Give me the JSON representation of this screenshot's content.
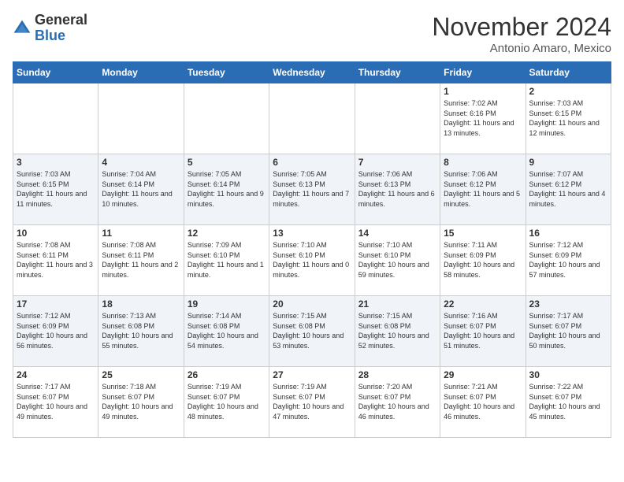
{
  "header": {
    "logo_general": "General",
    "logo_blue": "Blue",
    "month_title": "November 2024",
    "location": "Antonio Amaro, Mexico"
  },
  "days_of_week": [
    "Sunday",
    "Monday",
    "Tuesday",
    "Wednesday",
    "Thursday",
    "Friday",
    "Saturday"
  ],
  "weeks": [
    [
      {
        "day": "",
        "content": ""
      },
      {
        "day": "",
        "content": ""
      },
      {
        "day": "",
        "content": ""
      },
      {
        "day": "",
        "content": ""
      },
      {
        "day": "",
        "content": ""
      },
      {
        "day": "1",
        "content": "Sunrise: 7:02 AM\nSunset: 6:16 PM\nDaylight: 11 hours and 13 minutes."
      },
      {
        "day": "2",
        "content": "Sunrise: 7:03 AM\nSunset: 6:15 PM\nDaylight: 11 hours and 12 minutes."
      }
    ],
    [
      {
        "day": "3",
        "content": "Sunrise: 7:03 AM\nSunset: 6:15 PM\nDaylight: 11 hours and 11 minutes."
      },
      {
        "day": "4",
        "content": "Sunrise: 7:04 AM\nSunset: 6:14 PM\nDaylight: 11 hours and 10 minutes."
      },
      {
        "day": "5",
        "content": "Sunrise: 7:05 AM\nSunset: 6:14 PM\nDaylight: 11 hours and 9 minutes."
      },
      {
        "day": "6",
        "content": "Sunrise: 7:05 AM\nSunset: 6:13 PM\nDaylight: 11 hours and 7 minutes."
      },
      {
        "day": "7",
        "content": "Sunrise: 7:06 AM\nSunset: 6:13 PM\nDaylight: 11 hours and 6 minutes."
      },
      {
        "day": "8",
        "content": "Sunrise: 7:06 AM\nSunset: 6:12 PM\nDaylight: 11 hours and 5 minutes."
      },
      {
        "day": "9",
        "content": "Sunrise: 7:07 AM\nSunset: 6:12 PM\nDaylight: 11 hours and 4 minutes."
      }
    ],
    [
      {
        "day": "10",
        "content": "Sunrise: 7:08 AM\nSunset: 6:11 PM\nDaylight: 11 hours and 3 minutes."
      },
      {
        "day": "11",
        "content": "Sunrise: 7:08 AM\nSunset: 6:11 PM\nDaylight: 11 hours and 2 minutes."
      },
      {
        "day": "12",
        "content": "Sunrise: 7:09 AM\nSunset: 6:10 PM\nDaylight: 11 hours and 1 minute."
      },
      {
        "day": "13",
        "content": "Sunrise: 7:10 AM\nSunset: 6:10 PM\nDaylight: 11 hours and 0 minutes."
      },
      {
        "day": "14",
        "content": "Sunrise: 7:10 AM\nSunset: 6:10 PM\nDaylight: 10 hours and 59 minutes."
      },
      {
        "day": "15",
        "content": "Sunrise: 7:11 AM\nSunset: 6:09 PM\nDaylight: 10 hours and 58 minutes."
      },
      {
        "day": "16",
        "content": "Sunrise: 7:12 AM\nSunset: 6:09 PM\nDaylight: 10 hours and 57 minutes."
      }
    ],
    [
      {
        "day": "17",
        "content": "Sunrise: 7:12 AM\nSunset: 6:09 PM\nDaylight: 10 hours and 56 minutes."
      },
      {
        "day": "18",
        "content": "Sunrise: 7:13 AM\nSunset: 6:08 PM\nDaylight: 10 hours and 55 minutes."
      },
      {
        "day": "19",
        "content": "Sunrise: 7:14 AM\nSunset: 6:08 PM\nDaylight: 10 hours and 54 minutes."
      },
      {
        "day": "20",
        "content": "Sunrise: 7:15 AM\nSunset: 6:08 PM\nDaylight: 10 hours and 53 minutes."
      },
      {
        "day": "21",
        "content": "Sunrise: 7:15 AM\nSunset: 6:08 PM\nDaylight: 10 hours and 52 minutes."
      },
      {
        "day": "22",
        "content": "Sunrise: 7:16 AM\nSunset: 6:07 PM\nDaylight: 10 hours and 51 minutes."
      },
      {
        "day": "23",
        "content": "Sunrise: 7:17 AM\nSunset: 6:07 PM\nDaylight: 10 hours and 50 minutes."
      }
    ],
    [
      {
        "day": "24",
        "content": "Sunrise: 7:17 AM\nSunset: 6:07 PM\nDaylight: 10 hours and 49 minutes."
      },
      {
        "day": "25",
        "content": "Sunrise: 7:18 AM\nSunset: 6:07 PM\nDaylight: 10 hours and 49 minutes."
      },
      {
        "day": "26",
        "content": "Sunrise: 7:19 AM\nSunset: 6:07 PM\nDaylight: 10 hours and 48 minutes."
      },
      {
        "day": "27",
        "content": "Sunrise: 7:19 AM\nSunset: 6:07 PM\nDaylight: 10 hours and 47 minutes."
      },
      {
        "day": "28",
        "content": "Sunrise: 7:20 AM\nSunset: 6:07 PM\nDaylight: 10 hours and 46 minutes."
      },
      {
        "day": "29",
        "content": "Sunrise: 7:21 AM\nSunset: 6:07 PM\nDaylight: 10 hours and 46 minutes."
      },
      {
        "day": "30",
        "content": "Sunrise: 7:22 AM\nSunset: 6:07 PM\nDaylight: 10 hours and 45 minutes."
      }
    ]
  ]
}
